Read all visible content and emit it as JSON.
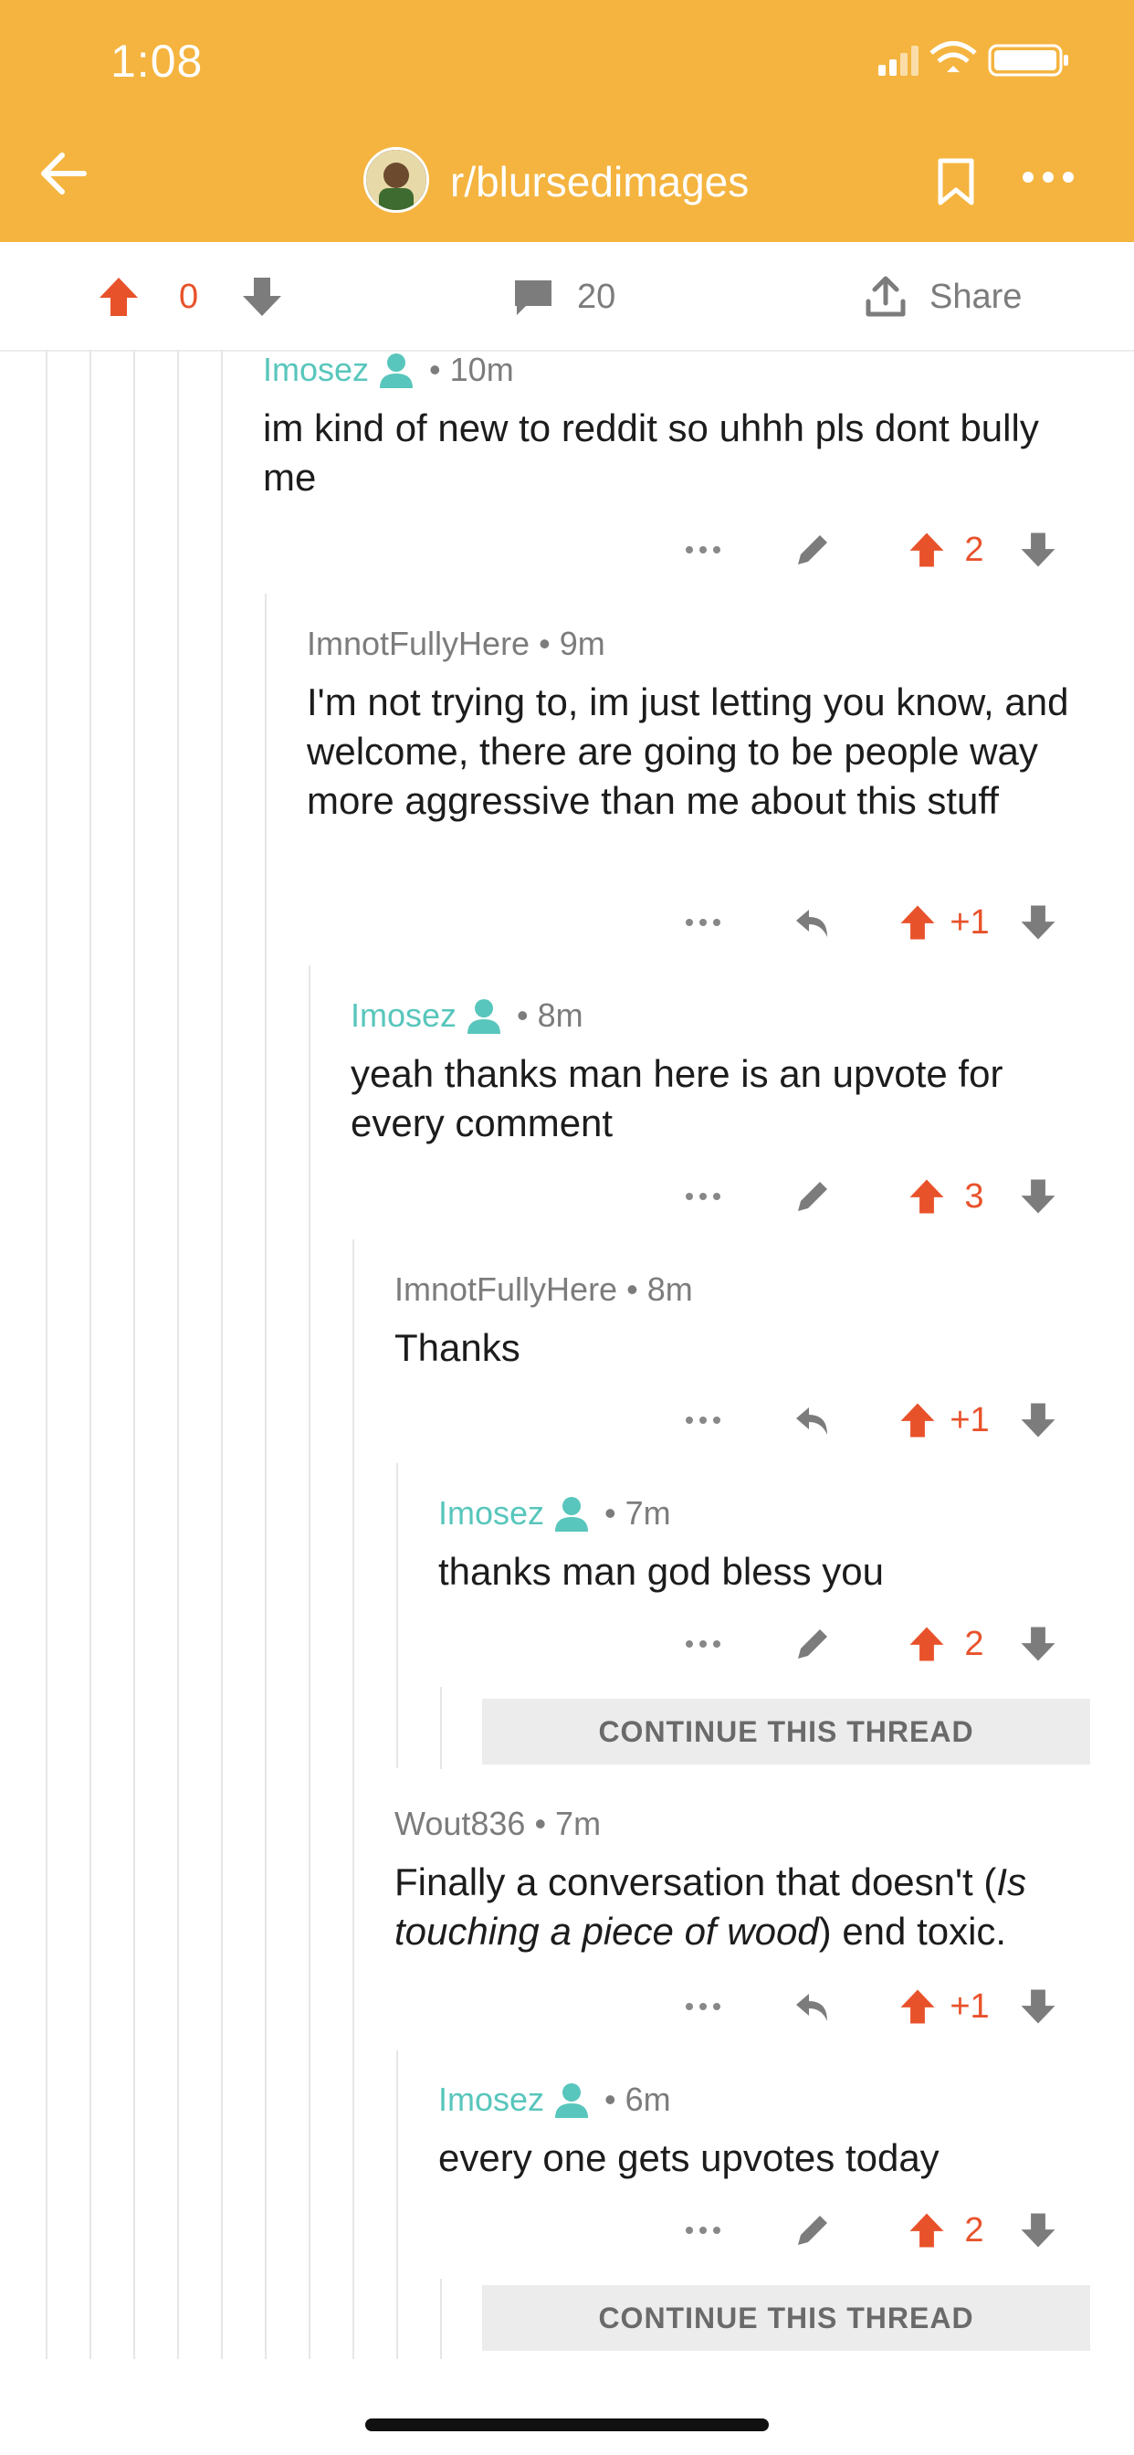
{
  "status": {
    "time": "1:08"
  },
  "header": {
    "subreddit": "r/blursedimages"
  },
  "post_actions": {
    "score": "0",
    "comments": "20",
    "share": "Share"
  },
  "comments": [
    {
      "author": "Imosez",
      "op": true,
      "time": "10m",
      "text": "im kind of new to reddit so uhhh pls dont bully me",
      "score": "2"
    },
    {
      "author": "ImnotFullyHere",
      "op": false,
      "time": "9m",
      "text": "I'm not trying to, im just letting you know, and welcome, there are going to be people way more aggressive than me about this stuff",
      "score": "+1"
    },
    {
      "author": "Imosez",
      "op": true,
      "time": "8m",
      "text": "yeah thanks man here is an upvote for every comment",
      "score": "3"
    },
    {
      "author": "ImnotFullyHere",
      "op": false,
      "time": "8m",
      "text": "Thanks",
      "score": "+1"
    },
    {
      "author": "Imosez",
      "op": true,
      "time": "7m",
      "text": "thanks man god bless you",
      "score": "2"
    },
    {
      "author": "Wout836",
      "op": false,
      "time": "7m",
      "text_pre": "Finally a conversation that doesn't (",
      "text_em": "Is touching a piece of wood",
      "text_post": ") end toxic.",
      "score": "+1"
    },
    {
      "author": "Imosez",
      "op": true,
      "time": "6m",
      "text": "every one gets upvotes today",
      "score": "2"
    }
  ],
  "continue_label": "CONTINUE THIS THREAD",
  "colors": {
    "header": "#F4B43F",
    "upvote": "#E8522B",
    "op": "#58C6BC"
  },
  "icons": [
    "back-arrow-icon",
    "bookmark-icon",
    "more-icon",
    "upvote-icon",
    "downvote-icon",
    "comment-icon",
    "share-icon",
    "edit-icon",
    "reply-icon",
    "op-person-icon"
  ]
}
